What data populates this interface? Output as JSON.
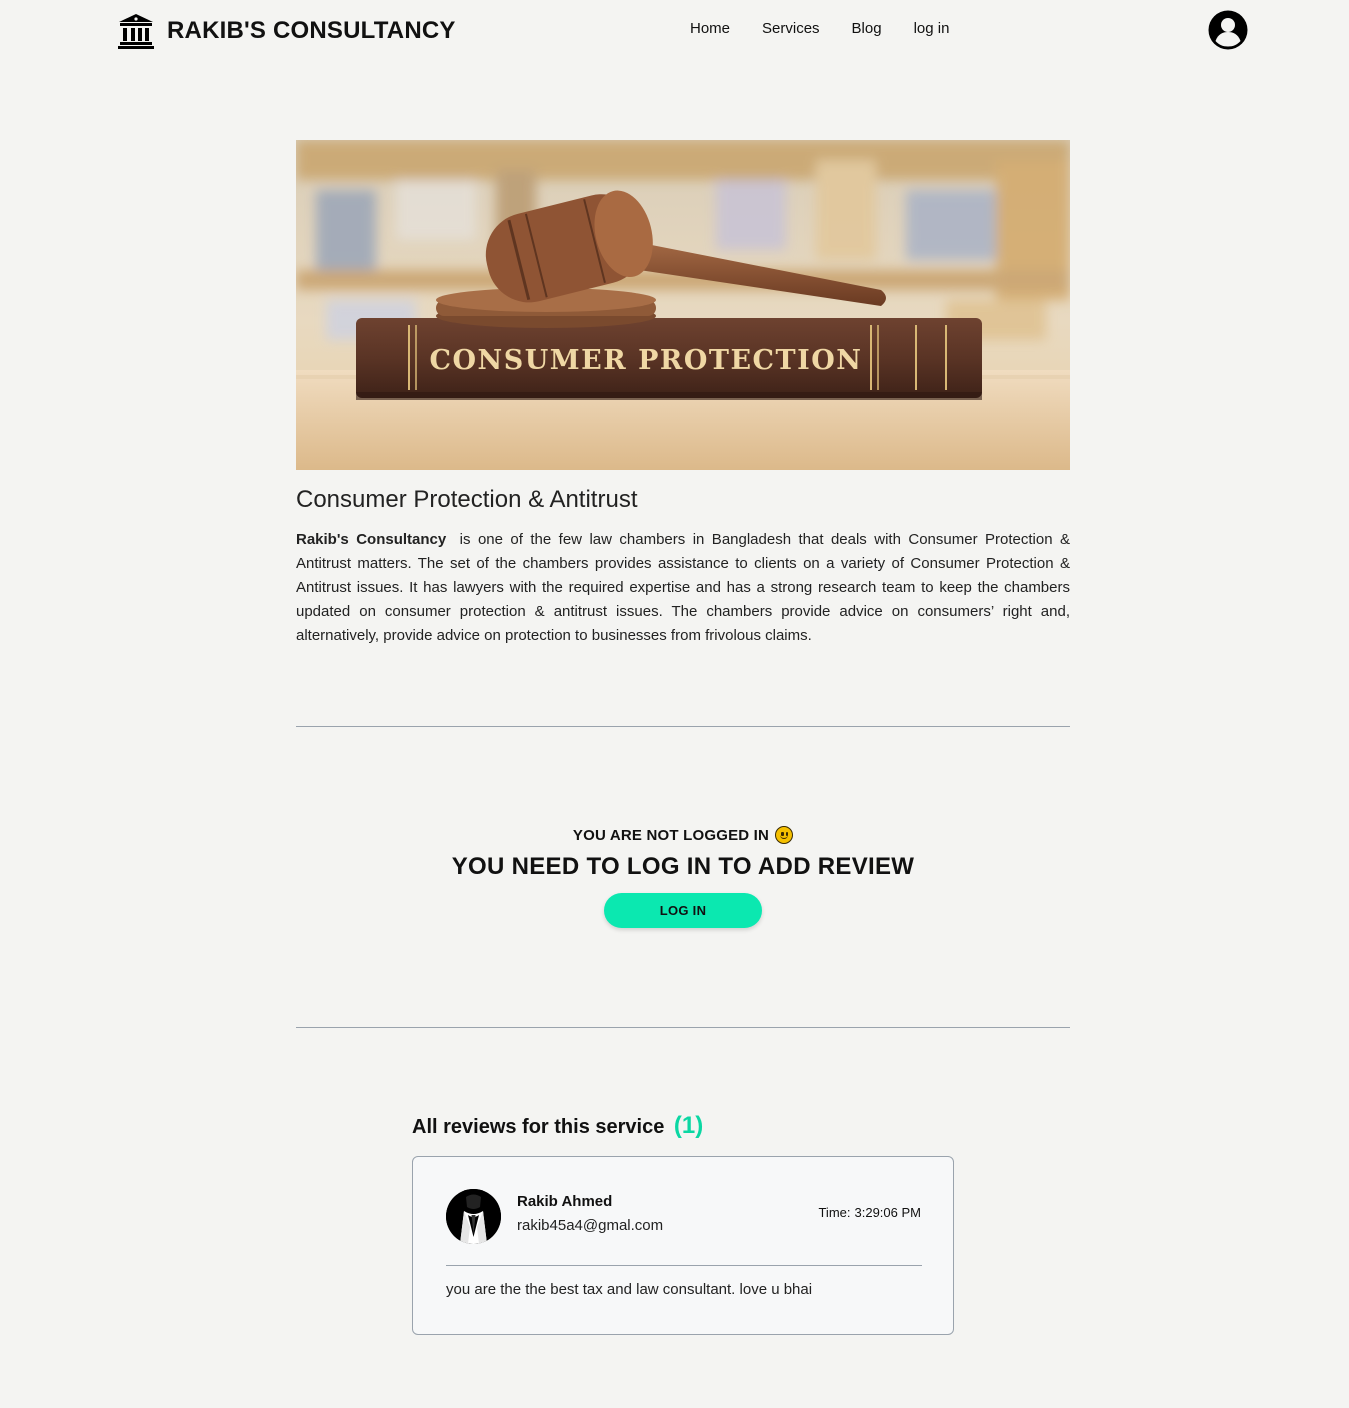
{
  "navbar": {
    "brand": "RAKIB'S CONSULTANCY",
    "brand_icon": "bank-building-icon",
    "links": [
      "Home",
      "Services",
      "Blog",
      "log in"
    ],
    "profile_icon": "user-circle-icon"
  },
  "hero": {
    "book_spine_text": "CONSUMER PROTECTION",
    "image": "gavel-on-book"
  },
  "service": {
    "title": "Consumer Protection & Antitrust",
    "company_name": "Rakib's Consultancy",
    "description": "is one of the few law chambers in Bangladesh that deals with Consumer Protection & Antitrust matters. The set of the chambers provides assistance to clients on a variety of Consumer Protection & Antitrust issues. It has lawyers with the required expertise and has a strong research team to keep the chambers updated on consumer protection & antitrust issues. The chambers provide advice on consumers’ right and, alternatively, provide advice on protection to businesses from frivolous claims."
  },
  "login_prompt": {
    "not_logged_text": "YOU ARE NOT LOGGED IN",
    "need_login_text": "YOU NEED TO LOG IN TO ADD REVIEW",
    "button_label": "LOG IN",
    "accent_color": "#0be8b0"
  },
  "reviews": {
    "heading": "All reviews for this service",
    "count": "(1)",
    "items": [
      {
        "name": "Rakib Ahmed",
        "email": "rakib45a4@gmal.com",
        "time_label": "Time:",
        "time": "3:29:06 PM",
        "text": "you are the the best tax and law consultant. love u bhai"
      }
    ]
  }
}
